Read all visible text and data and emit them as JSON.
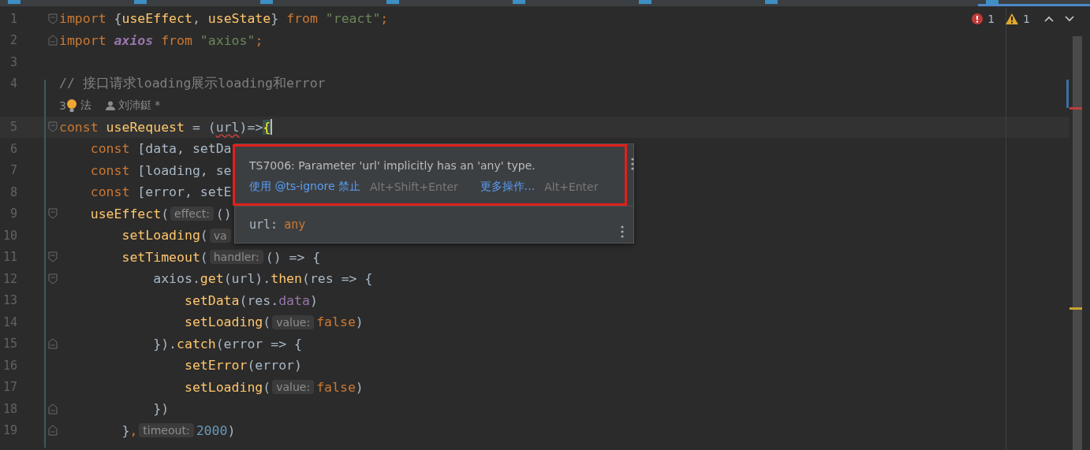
{
  "tabs": [
    {
      "selected": false
    },
    {
      "selected": false
    },
    {
      "selected": false
    },
    {
      "selected": false
    },
    {
      "selected": false
    },
    {
      "selected": false
    },
    {
      "selected": false
    },
    {
      "selected": true
    }
  ],
  "inspections": {
    "errors": "1",
    "warnings": "1"
  },
  "lines": [
    {
      "kind": "code",
      "number": "1",
      "fold_start": true,
      "current": false,
      "tokens": [
        {
          "kind": "keyword",
          "text": "import "
        },
        {
          "kind": "plain",
          "text": "{"
        },
        {
          "kind": "func",
          "text": "useEffect"
        },
        {
          "kind": "plain",
          "text": ", "
        },
        {
          "kind": "func",
          "text": "useState"
        },
        {
          "kind": "plain",
          "text": "} "
        },
        {
          "kind": "keyword",
          "text": "from "
        },
        {
          "kind": "string",
          "text": "\"react\""
        },
        {
          "kind": "keyword",
          "text": ";"
        }
      ]
    },
    {
      "kind": "code",
      "number": "2",
      "fold_end": true,
      "current": false,
      "tokens": [
        {
          "kind": "keyword",
          "text": "import "
        },
        {
          "kind": "italic",
          "text": "axios"
        },
        {
          "kind": "keyword",
          "text": " from "
        },
        {
          "kind": "string",
          "text": "\"axios\""
        },
        {
          "kind": "keyword",
          "text": ";"
        }
      ]
    },
    {
      "kind": "code",
      "number": "3",
      "current": false
    },
    {
      "kind": "code",
      "number": "4",
      "current": false,
      "tokens": [
        {
          "kind": "comment",
          "text": "// 接口请求loading展示loading和error"
        }
      ]
    },
    {
      "kind": "usage",
      "usages": "3",
      "usages_tail": "法",
      "author": "刘沛鋌 *"
    },
    {
      "kind": "code",
      "number": "5",
      "fold_start": true,
      "current": true,
      "tokens": [
        {
          "kind": "keyword",
          "text": "const "
        },
        {
          "kind": "func",
          "text": "useRequest"
        },
        {
          "kind": "plain",
          "text": " = ("
        },
        {
          "kind": "error",
          "text": "url"
        },
        {
          "kind": "plain",
          "text": ")=>"
        },
        {
          "kind": "brace",
          "text": "{"
        }
      ]
    },
    {
      "kind": "code",
      "number": "6",
      "current": false,
      "tokens": [
        {
          "kind": "keyword",
          "text": "    const "
        },
        {
          "kind": "plain",
          "text": "[data, setDa"
        }
      ]
    },
    {
      "kind": "code",
      "number": "7",
      "current": false,
      "tokens": [
        {
          "kind": "keyword",
          "text": "    const "
        },
        {
          "kind": "plain",
          "text": "[loading, se"
        }
      ]
    },
    {
      "kind": "code",
      "number": "8",
      "current": false,
      "tokens": [
        {
          "kind": "keyword",
          "text": "    const "
        },
        {
          "kind": "plain",
          "text": "[error, setE"
        }
      ]
    },
    {
      "kind": "code",
      "number": "9",
      "fold_start": true,
      "current": false,
      "tokens": [
        {
          "kind": "func",
          "text": "    useEffect"
        },
        {
          "kind": "plain",
          "text": "("
        },
        {
          "kind": "hint",
          "text": "effect:"
        },
        {
          "kind": "plain",
          "text": "()"
        }
      ]
    },
    {
      "kind": "code",
      "number": "10",
      "current": false,
      "tokens": [
        {
          "kind": "func",
          "text": "        setLoading"
        },
        {
          "kind": "plain",
          "text": "("
        },
        {
          "kind": "hint",
          "text": "va"
        }
      ]
    },
    {
      "kind": "code",
      "number": "11",
      "fold_start": true,
      "current": false,
      "tokens": [
        {
          "kind": "func",
          "text": "        setTimeout"
        },
        {
          "kind": "plain",
          "text": "("
        },
        {
          "kind": "hint",
          "text": "handler:"
        },
        {
          "kind": "plain",
          "text": "() => {"
        }
      ]
    },
    {
      "kind": "code",
      "number": "12",
      "fold_start": true,
      "current": false,
      "tokens": [
        {
          "kind": "plain",
          "text": "            axios."
        },
        {
          "kind": "func",
          "text": "get"
        },
        {
          "kind": "plain",
          "text": "(url)."
        },
        {
          "kind": "func",
          "text": "then"
        },
        {
          "kind": "plain",
          "text": "(res => {"
        }
      ]
    },
    {
      "kind": "code",
      "number": "13",
      "current": false,
      "tokens": [
        {
          "kind": "func",
          "text": "                setData"
        },
        {
          "kind": "plain",
          "text": "(res."
        },
        {
          "kind": "prop",
          "text": "data"
        },
        {
          "kind": "plain",
          "text": ")"
        }
      ]
    },
    {
      "kind": "code",
      "number": "14",
      "current": false,
      "tokens": [
        {
          "kind": "func",
          "text": "                setLoading"
        },
        {
          "kind": "plain",
          "text": "("
        },
        {
          "kind": "hint",
          "text": "value:"
        },
        {
          "kind": "keyword",
          "text": "false"
        },
        {
          "kind": "plain",
          "text": ")"
        }
      ]
    },
    {
      "kind": "code",
      "number": "15",
      "fold_end": true,
      "current": false,
      "tokens": [
        {
          "kind": "plain",
          "text": "            })."
        },
        {
          "kind": "func",
          "text": "catch"
        },
        {
          "kind": "plain",
          "text": "(error => {"
        }
      ]
    },
    {
      "kind": "code",
      "number": "16",
      "current": false,
      "tokens": [
        {
          "kind": "func",
          "text": "                setError"
        },
        {
          "kind": "plain",
          "text": "(error)"
        }
      ]
    },
    {
      "kind": "code",
      "number": "17",
      "current": false,
      "tokens": [
        {
          "kind": "func",
          "text": "                setLoading"
        },
        {
          "kind": "plain",
          "text": "("
        },
        {
          "kind": "hint",
          "text": "value:"
        },
        {
          "kind": "keyword",
          "text": "false"
        },
        {
          "kind": "plain",
          "text": ")"
        }
      ]
    },
    {
      "kind": "code",
      "number": "18",
      "fold_end": true,
      "current": false,
      "tokens": [
        {
          "kind": "plain",
          "text": "            })"
        }
      ]
    },
    {
      "kind": "code",
      "number": "19",
      "fold_end": true,
      "current": false,
      "tokens": [
        {
          "kind": "plain",
          "text": "        }"
        },
        {
          "kind": "keyword",
          "text": ","
        },
        {
          "kind": "hint",
          "text": "timeout:"
        },
        {
          "kind": "number",
          "text": "2000"
        },
        {
          "kind": "plain",
          "text": ")"
        }
      ]
    }
  ],
  "popup": {
    "message": "TS7006: Parameter 'url' implicitly has an 'any' type.",
    "actions": [
      {
        "label": "使用 @ts-ignore 禁止",
        "shortcut": "Alt+Shift+Enter"
      },
      {
        "label": "更多操作...",
        "shortcut": "Alt+Enter"
      }
    ],
    "signature": {
      "name": "url:",
      "type": "any"
    }
  }
}
